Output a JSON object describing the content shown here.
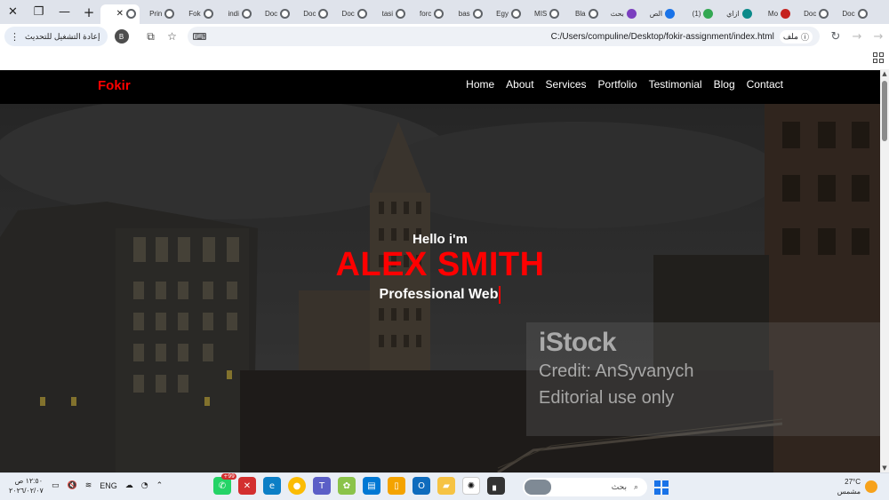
{
  "browser": {
    "window_controls": {
      "close": "✕",
      "restore": "❐",
      "minimize": "—"
    },
    "new_tab": "+",
    "tabs": [
      {
        "title": "",
        "icon": "globe",
        "active": true
      },
      {
        "title": "Prin",
        "icon": "globe"
      },
      {
        "title": "Fok",
        "icon": "globe"
      },
      {
        "title": "indi",
        "icon": "globe"
      },
      {
        "title": "Doc",
        "icon": "globe"
      },
      {
        "title": "Doc",
        "icon": "globe"
      },
      {
        "title": "Doc",
        "icon": "globe"
      },
      {
        "title": "tasi",
        "icon": "globe"
      },
      {
        "title": "forc",
        "icon": "globe"
      },
      {
        "title": "bas",
        "icon": "globe"
      },
      {
        "title": "Egy",
        "icon": "globe"
      },
      {
        "title": "MIS",
        "icon": "globe"
      },
      {
        "title": "Bla",
        "icon": "globe"
      },
      {
        "title": "بحث",
        "icon": "purple"
      },
      {
        "title": "الص",
        "icon": "blue"
      },
      {
        "title": "(1)",
        "icon": "green"
      },
      {
        "title": "ازاي",
        "icon": "teal"
      },
      {
        "title": "Mo",
        "icon": "red"
      },
      {
        "title": "Doc",
        "icon": "globe"
      },
      {
        "title": "Doc",
        "icon": "globe"
      }
    ],
    "update_button": "إعادة التشغيل للتحديث",
    "profile_initial": "B",
    "address": "C:/Users/compuline/Desktop/fokir-assignment/index.html",
    "file_chip": "ملف"
  },
  "site": {
    "brand": "Fokir",
    "nav": [
      "Home",
      "About",
      "Services",
      "Portfolio",
      "Testimonial",
      "Blog",
      "Contact"
    ],
    "hero": {
      "greeting": "Hello i'm",
      "name": "ALEX SMITH",
      "role": "Professional Web"
    },
    "watermark": {
      "brand": "iStock",
      "credit": "Credit: AnSyvanych",
      "note": "Editorial use only"
    }
  },
  "taskbar": {
    "time": "١٢:٥٠ ص",
    "date": "٢٠٢٦/٠٢/٠٧",
    "language": "ENG",
    "search_placeholder": "بحث",
    "temperature": "27°C",
    "weather": "مشمس",
    "whatsapp_badge": "+99"
  },
  "colors": {
    "accent": "#ff0000",
    "nav_bg": "#000000",
    "tabstrip_bg": "#dfe3eb"
  }
}
